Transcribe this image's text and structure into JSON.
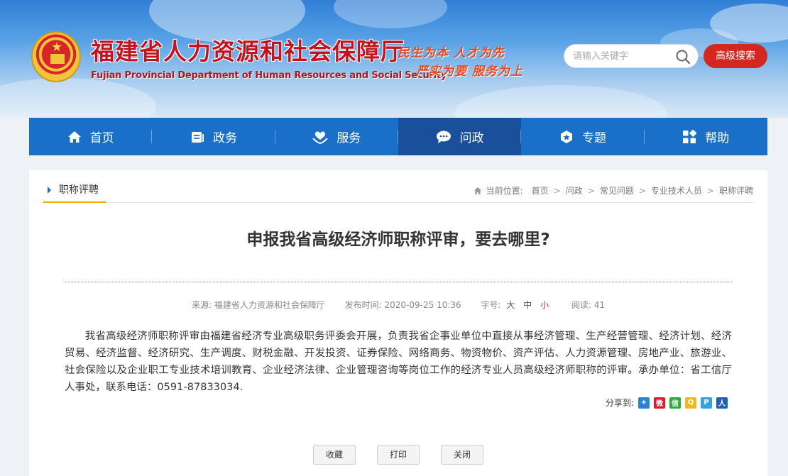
{
  "header": {
    "title": "福建省人力资源和社会保障厅",
    "subtitle": "Fujian Provincial Department of Human Resources and Social Security",
    "slogan_line1": "民生为本 人才为先",
    "slogan_line2": "严实为要 服务为上",
    "search_placeholder": "请输入关键字",
    "adv_search_label": "高级搜索"
  },
  "nav": [
    {
      "label": "首页",
      "icon": "home-icon"
    },
    {
      "label": "政务",
      "icon": "document-icon"
    },
    {
      "label": "服务",
      "icon": "service-icon"
    },
    {
      "label": "问政",
      "icon": "chat-icon",
      "active": true
    },
    {
      "label": "专题",
      "icon": "badge-icon"
    },
    {
      "label": "帮助",
      "icon": "grid-icon"
    }
  ],
  "section": {
    "tab_label": "职称评聘",
    "breadcrumb_prefix": "当前位置:",
    "breadcrumb": [
      "首页",
      "问政",
      "常见问题",
      "专业技术人员",
      "职称评聘"
    ]
  },
  "article": {
    "title": "申报我省高级经济师职称评审，要去哪里?",
    "source_label": "来源:",
    "source": "福建省人力资源和社会保障厅",
    "time_label": "发布时间:",
    "time": "2020-09-25 10:36",
    "fontsize_label": "字号:",
    "fontsize_large": "大",
    "fontsize_medium": "中",
    "fontsize_small": "小",
    "views_label": "阅读:",
    "views": "41",
    "body": "我省高级经济师职称评审由福建省经济专业高级职务评委会开展，负责我省企事业单位中直接从事经济管理、生产经营管理、经济计划、经济贸易、经济监督、经济研究、生产调度、财税金融、开发投资、证券保险、网络商务、物资物价、资产评估、人力资源管理、房地产业、旅游业、社会保险以及企业职工专业技术培训教育、企业经济法律、企业管理咨询等岗位工作的经济专业人员高级经济师职称的评审。承办单位：省工信厅人事处，联系电话：0591-87833034."
  },
  "share": {
    "label": "分享到:",
    "targets": [
      {
        "name": "more-share-icon",
        "color": "#2a83d6",
        "glyph": "+"
      },
      {
        "name": "weibo-icon",
        "color": "#e6162d",
        "glyph": "微"
      },
      {
        "name": "wechat-icon",
        "color": "#2aae3b",
        "glyph": "信"
      },
      {
        "name": "qzone-icon",
        "color": "#f4b81c",
        "glyph": "Q"
      },
      {
        "name": "tencent-weibo-icon",
        "color": "#31a4e0",
        "glyph": "P"
      },
      {
        "name": "renren-icon",
        "color": "#1e5fb8",
        "glyph": "人"
      }
    ]
  },
  "buttons": {
    "collect": "收藏",
    "print": "打印",
    "close": "关闭"
  },
  "colors": {
    "nav_bg": "#1a70c9",
    "nav_active": "#1a4f9c",
    "accent_red": "#d2281f",
    "tab_underline": "#f0a500"
  }
}
